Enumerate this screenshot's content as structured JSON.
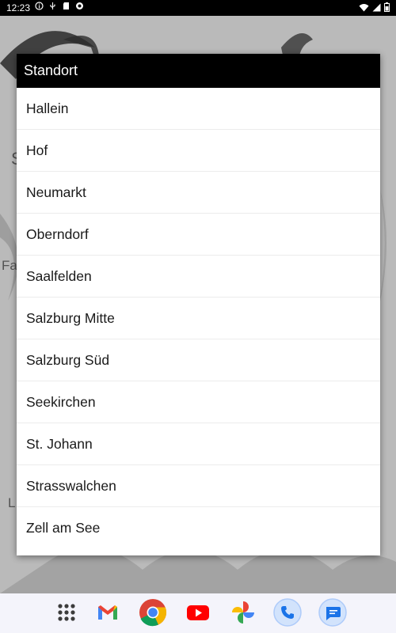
{
  "status_bar": {
    "time": "12:23",
    "left_icons": [
      "info-icon",
      "usb-icon",
      "sd-card-icon",
      "app-notification-icon"
    ],
    "right_icons": [
      "wifi-icon",
      "signal-icon",
      "battery-icon"
    ]
  },
  "background": {
    "fragments": [
      "S",
      "Fa",
      "L"
    ]
  },
  "dialog": {
    "title": "Standort",
    "options": [
      "Hallein",
      "Hof",
      "Neumarkt",
      "Oberndorf",
      "Saalfelden",
      "Salzburg Mitte",
      "Salzburg Süd",
      "Seekirchen",
      "St. Johann",
      "Strasswalchen",
      "Zell am See"
    ]
  },
  "dock": {
    "apps": [
      "app-drawer-icon",
      "gmail-icon",
      "chrome-icon",
      "youtube-icon",
      "photos-icon",
      "phone-icon",
      "messages-icon"
    ]
  },
  "colors": {
    "dialog_title_bg": "#000000",
    "dialog_bg": "#ffffff",
    "divider": "#ececec"
  }
}
